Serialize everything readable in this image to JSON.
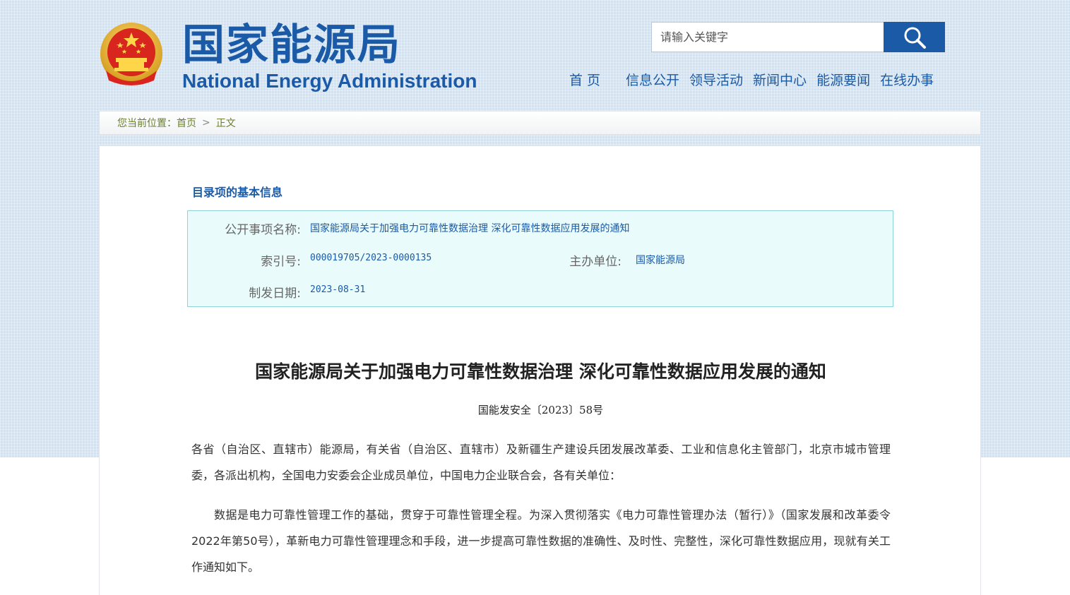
{
  "header": {
    "brand_cn": "国家能源局",
    "brand_en": "National Energy Administration",
    "search_placeholder": "请输入关键字",
    "nav": [
      "首页",
      "信息公开",
      "领导活动",
      "新闻中心",
      "能源要闻",
      "在线办事"
    ]
  },
  "breadcrumb": {
    "prefix": "您当前位置：",
    "home": "首页",
    "separator": ">",
    "current": "正文"
  },
  "catalog": {
    "title": "目录项的基本信息",
    "name_label": "公开事项名称:",
    "name_value": "国家能源局关于加强电力可靠性数据治理 深化可靠性数据应用发展的通知",
    "index_label": "索引号:",
    "index_value": "000019705/2023-0000135",
    "org_label": "主办单位:",
    "org_value": "国家能源局",
    "date_label": "制发日期:",
    "date_value": "2023-08-31"
  },
  "document": {
    "title": "国家能源局关于加强电力可靠性数据治理 深化可靠性数据应用发展的通知",
    "number": "国能发安全〔2023〕58号",
    "recipients": "各省（自治区、直辖市）能源局，有关省（自治区、直辖市）及新疆生产建设兵团发展改革委、工业和信息化主管部门，北京市城市管理委，各派出机构，全国电力安委会企业成员单位，中国电力企业联合会，各有关单位：",
    "paragraph1": "数据是电力可靠性管理工作的基础，贯穿于可靠性管理全程。为深入贯彻落实《电力可靠性管理办法（暂行）》（国家发展和改革委令2022年第50号），革新电力可靠性管理理念和手段，进一步提高可靠性数据的准确性、及时性、完整性，深化可靠性数据应用，现就有关工作通知如下。"
  },
  "colors": {
    "brand_blue": "#1a5aa6",
    "header_bg": "#cfe3f5",
    "info_box_bg": "#e9fbfb",
    "info_box_border": "#8fd3d8",
    "breadcrumb_text": "#6a7f2a"
  }
}
